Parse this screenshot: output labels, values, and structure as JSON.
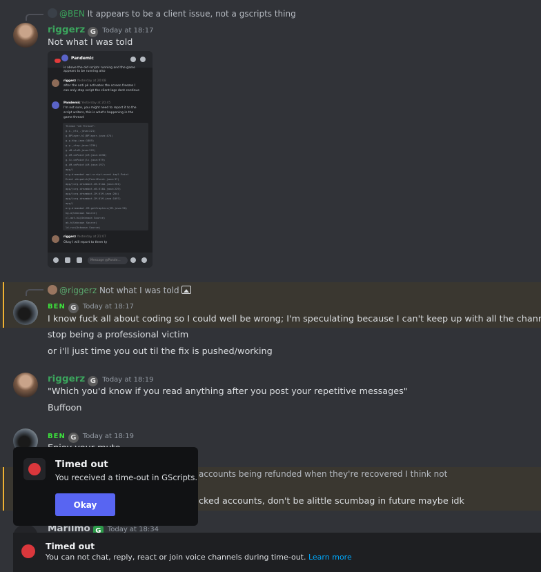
{
  "messages": {
    "m1": {
      "reply_mention": "@BEN",
      "reply_text": "It appears to be a client issue, not a gscripts thing",
      "author": "riggerz",
      "timestamp": "Today at 18:17",
      "text": "Not what I was told"
    },
    "m2": {
      "reply_mention": "@riggerz",
      "reply_text": "Not what I was told",
      "author": "BEN",
      "timestamp": "Today at 18:17",
      "lines": [
        "I know fuck all about coding so I could well be wrong; I'm speculating because I can't keep up with all the channels",
        "stop being a professional victim",
        "or i'll just time you out til the fix is pushed/working"
      ]
    },
    "m3": {
      "author": "riggerz",
      "timestamp": "Today at 18:19",
      "lines": [
        "\"Which you'd know if you read anything after you post your repetitive messages\"",
        "Buffoon"
      ]
    },
    "m4": {
      "author": "BEN",
      "timestamp": "Today at 18:19",
      "partial_line": "Enjoy your mute"
    },
    "m5": {
      "partial_reply": "accounts being refunded when they're recovered I think not",
      "partial_line": "cked accounts, don't be alittle scumbag in future maybe idk"
    },
    "m6": {
      "author": "Marilmo",
      "timestamp": "Today at 18:34"
    }
  },
  "embedded_screenshot": {
    "channel": "Pandemic",
    "msg1_text": "is above the old scripts running and the game appears to be running also",
    "msg2_author": "riggerz",
    "msg2_time": "Yesterday at 20:08",
    "msg2_lines": [
      "after the anti pk activates the screen freezes I",
      "can only stop script the client lags dont continue"
    ],
    "msg3_author": "Pandemic",
    "msg3_time": "Yesterday at 20:45",
    "msg3_lines": [
      "I'm not sure, you might need to report it to the",
      "script writers, this is what's happening in the",
      "game thread:"
    ],
    "code_lines": [
      "Thread \"AG Thread\":",
      "    g.c._nti_.java:221)",
      "    g.BPlayer.hI(BPlayer.java:474)",
      "    g.p.hkp.java:1889)",
      "    g.p._stop.java:1236)",
      "    g.nM.oleM.java:222)",
      "    g.iM.onPaint(iM.java:1638)",
      "    g.lc.onPaint(lc.java:979)",
      "    g.iM.onPaint(iM.java:197)",
      "    app//",
      "org.dreambot.api.script.event.impl.Paint",
      "Event.dispatch(PaintEvent.java:37)",
      "    app//org.dreambot.eB.KlaA.java:261)",
      "    app//org.dreambot.eB.Kl6A.java:229)",
      "    app//org.dreambot.2M.KlM.java:204)",
      "    app//org.dreambot.2M.KlM.java:1097)",
      "    app//",
      "org.dreambot.2M.getGraphics(2M.java:90)",
      "    kg.a(Unknown Source)",
      "    cl.aot.hA(Unknown Source)",
      "    ak.h(Unknown Source)",
      "  ld.run(Unknown Source)"
    ],
    "msg4_author": "riggerz",
    "msg4_time": "Yesterday at 21:07",
    "msg4_text": "Okay I will report to them ty",
    "input_placeholder": "Message @Pande..."
  },
  "modal": {
    "title": "Timed out",
    "text": "You received a time-out in GScripts.",
    "button": "Okay"
  },
  "notice": {
    "title": "Timed out",
    "text": "You can not chat, reply, react or join voice channels during time-out.",
    "link": "Learn more"
  },
  "colors": {
    "background": "#313338",
    "highlight": "#3a3730",
    "highlight_bar": "#f0b232",
    "riggerz_name": "#3ba55d",
    "ben_name": "#3ce13c",
    "primary_button": "#5865f2",
    "danger": "#da373c",
    "link": "#00a8fc"
  },
  "icons": [
    "g-badge-icon",
    "image-attachment-icon",
    "timeout-clock-icon",
    "phone-icon",
    "video-icon",
    "plus-icon",
    "emoji-icon",
    "mic-icon"
  ]
}
